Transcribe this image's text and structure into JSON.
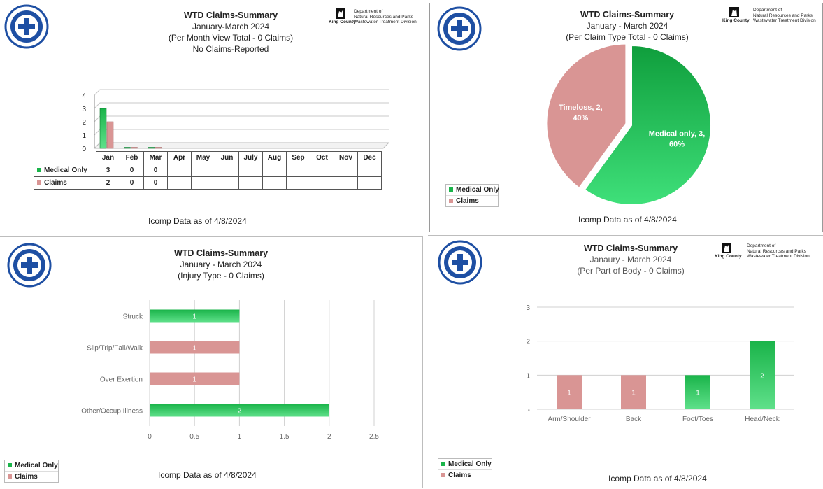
{
  "colors": {
    "medical": "#1ab44a",
    "medical_light": "#5fe08a",
    "claims": "#d99594",
    "grid": "#d0d0d0",
    "axis_text": "#666666"
  },
  "kc_header": {
    "county": "King County",
    "dept_line1": "Department of",
    "dept_line2": "Natural Resources and Parks",
    "division": "Wastewater Treatment Division"
  },
  "panels": {
    "month": {
      "title": "WTD Claims-Summary",
      "subtitle": "January-March  2024",
      "subtitle2": "(Per Month View Total - 0 Claims)",
      "subtitle3": "No Claims-Reported",
      "footer": "Icomp Data as of  4/8/2024"
    },
    "type": {
      "title": "WTD Claims-Summary",
      "subtitle": "January - March 2024",
      "subtitle2": "(Per Claim Type Total - 0 Claims)",
      "footer": "Icomp Data as of  4/8/2024"
    },
    "injury": {
      "title": "WTD Claims-Summary",
      "subtitle": "January - March 2024",
      "subtitle2": "(Injury Type - 0 Claims)",
      "footer": "Icomp Data as of 4/8/2024"
    },
    "body": {
      "title": "WTD Claims-Summary",
      "subtitle": "Janaury - March 2024",
      "subtitle2": "(Per Part of Body - 0 Claims)",
      "footer": "Icomp Data as of 4/8/2024"
    }
  },
  "legend": {
    "medical": "Medical Only",
    "claims": "Claims"
  },
  "chart_data": [
    {
      "type": "bar",
      "categories": [
        "Jan",
        "Feb",
        "Mar",
        "Apr",
        "May",
        "Jun",
        "July",
        "Aug",
        "Sep",
        "Oct",
        "Nov",
        "Dec"
      ],
      "series": [
        {
          "name": "Medical Only",
          "values": [
            3,
            0,
            0,
            null,
            null,
            null,
            null,
            null,
            null,
            null,
            null,
            null
          ]
        },
        {
          "name": "Claims",
          "values": [
            2,
            0,
            0,
            null,
            null,
            null,
            null,
            null,
            null,
            null,
            null,
            null
          ]
        }
      ],
      "table": {
        "medical": [
          "3",
          "0",
          "0",
          "",
          "",
          "",
          "",
          "",
          "",
          "",
          "",
          ""
        ],
        "claims": [
          "2",
          "0",
          "0",
          "",
          "",
          "",
          "",
          "",
          "",
          "",
          "",
          ""
        ]
      },
      "yticks": [
        "4",
        "3",
        "2",
        "1",
        "0"
      ],
      "ylim": [
        0,
        4
      ],
      "grid": true
    },
    {
      "type": "pie",
      "slices": [
        {
          "label": "Medical only",
          "value": 3,
          "percent": "60%",
          "text": "Medical only, 3,"
        },
        {
          "label": "Timeloss",
          "value": 2,
          "percent": "40%",
          "text": "Timeloss, 2,"
        }
      ]
    },
    {
      "type": "bar",
      "orientation": "horizontal",
      "categories": [
        "Struck",
        "Slip/Trip/Fall/Walk",
        "Over Exertion",
        "Other/Occup Illness"
      ],
      "values": [
        1,
        1,
        1,
        2
      ],
      "series_of_category": [
        "medical",
        "claims",
        "claims",
        "medical"
      ],
      "labels": [
        "1",
        "1",
        "1",
        "2"
      ],
      "xticks": [
        "0",
        "0.5",
        "1",
        "1.5",
        "2",
        "2.5"
      ],
      "xlim": [
        0,
        2.5
      ],
      "grid": true
    },
    {
      "type": "bar",
      "categories": [
        "Arm/Shoulder",
        "Back",
        "Foot/Toes",
        "Head/Neck"
      ],
      "values": [
        1,
        1,
        1,
        2
      ],
      "series_of_category": [
        "claims",
        "claims",
        "medical",
        "medical"
      ],
      "labels": [
        "1",
        "1",
        "1",
        "2"
      ],
      "yticks": [
        "3",
        "2",
        "1",
        "-"
      ],
      "ylim": [
        0,
        3
      ],
      "grid": true
    }
  ]
}
